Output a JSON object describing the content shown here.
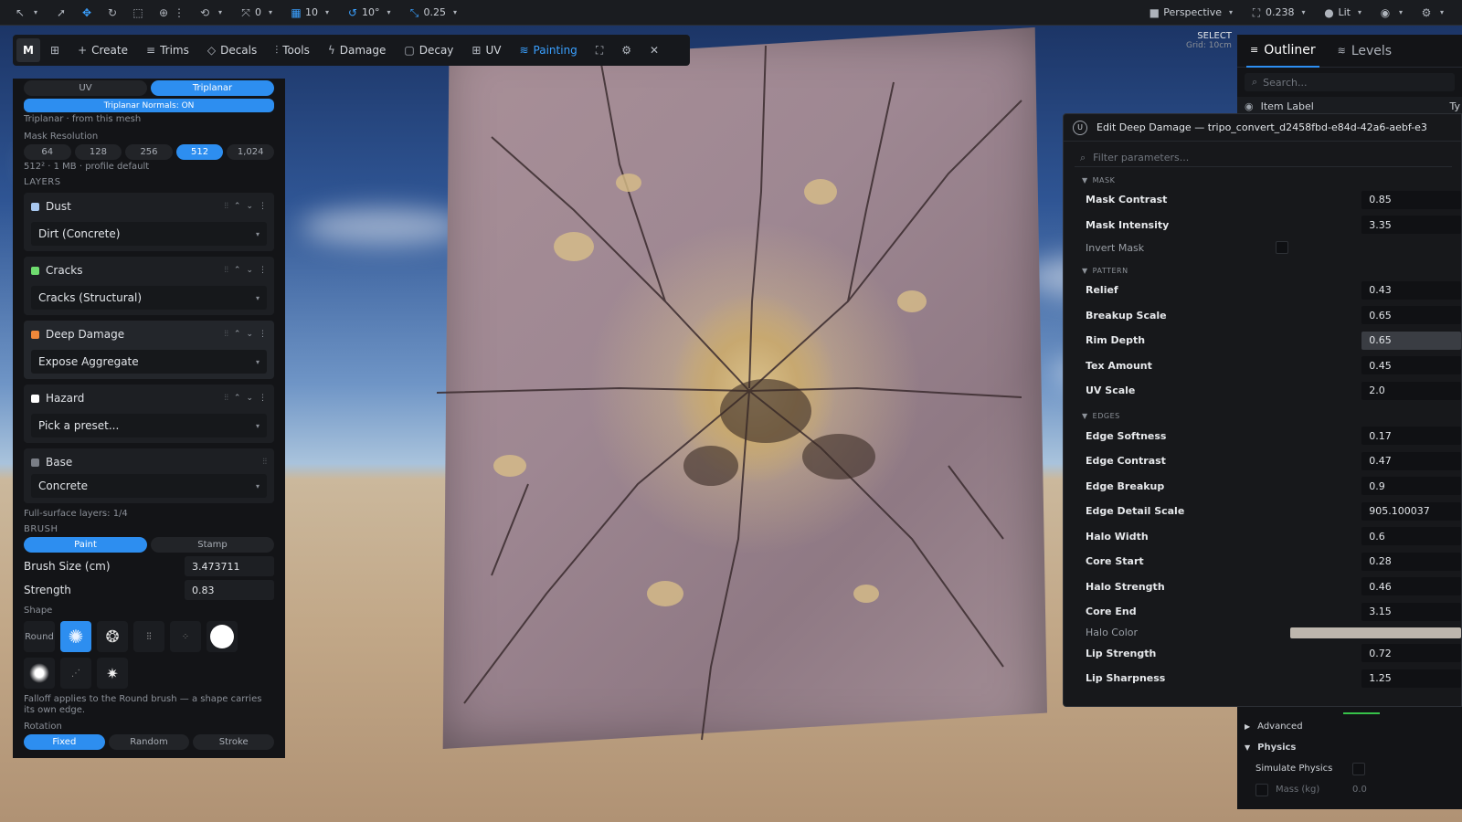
{
  "topbar": {
    "rot_snap": "0",
    "grid_snap": "10",
    "angle_snap": "10°",
    "scale_snap": "0.25",
    "view_mode": "Perspective",
    "camera_speed": "0.238",
    "lit_mode": "Lit"
  },
  "select_mode": {
    "label": "SELECT",
    "grid": "Grid: 10cm"
  },
  "toolbar": {
    "m_label": "M",
    "create": "Create",
    "trims": "Trims",
    "decals": "Decals",
    "tools": "Tools",
    "damage": "Damage",
    "decay": "Decay",
    "uv": "UV",
    "painting": "Painting"
  },
  "left_panel": {
    "mapping_uv": "UV",
    "mapping_triplanar": "Triplanar",
    "triplanar_normals": "Triplanar Normals: ON",
    "triplanar_note": "Triplanar · from this mesh",
    "mask_resolution_label": "Mask Resolution",
    "resolutions": [
      "64",
      "128",
      "256",
      "512",
      "1,024"
    ],
    "resolution_note": "512² · 1 MB · profile default",
    "layers_label": "LAYERS",
    "layers": [
      {
        "name": "Dust",
        "preset": "Dirt (Concrete)",
        "color": "#a8c8f0"
      },
      {
        "name": "Cracks",
        "preset": "Cracks (Structural)",
        "color": "#6fdc6f"
      },
      {
        "name": "Deep Damage",
        "preset": "Expose Aggregate",
        "color": "#f0883a"
      },
      {
        "name": "Hazard",
        "preset": "Pick a preset...",
        "color": "#ffffff"
      },
      {
        "name": "Base",
        "preset": "Concrete",
        "color": "#7a7e86"
      }
    ],
    "full_surface": "Full-surface layers: 1/4",
    "brush_label": "BRUSH",
    "brush_paint": "Paint",
    "brush_stamp": "Stamp",
    "brush_size_label": "Brush Size (cm)",
    "brush_size_value": "3.473711",
    "strength_label": "Strength",
    "strength_value": "0.83",
    "shape_label": "Shape",
    "shape_round": "Round",
    "falloff_note": "Falloff applies to the Round brush — a shape carries its own edge.",
    "rotation_label": "Rotation",
    "rotation_fixed": "Fixed",
    "rotation_random": "Random",
    "rotation_stroke": "Stroke"
  },
  "outliner": {
    "tab_outliner": "Outliner",
    "tab_levels": "Levels",
    "search_placeholder": "Search...",
    "col_item_label": "Item Label",
    "col_type": "Ty"
  },
  "edit_panel": {
    "title": "Edit Deep Damage — tripo_convert_d2458fbd-e84d-42a6-aebf-e3",
    "filter_placeholder": "Filter parameters...",
    "sections": {
      "mask": "MASK",
      "pattern": "PATTERN",
      "edges": "EDGES"
    },
    "mask_params": [
      {
        "name": "Mask Contrast",
        "value": "0.85"
      },
      {
        "name": "Mask Intensity",
        "value": "3.35"
      }
    ],
    "invert_mask": "Invert Mask",
    "pattern_params": [
      {
        "name": "Relief",
        "value": "0.43"
      },
      {
        "name": "Breakup Scale",
        "value": "0.65"
      },
      {
        "name": "Rim Depth",
        "value": "0.65"
      },
      {
        "name": "Tex Amount",
        "value": "0.45"
      },
      {
        "name": "UV Scale",
        "value": "2.0"
      }
    ],
    "edge_params": [
      {
        "name": "Edge Softness",
        "value": "0.17"
      },
      {
        "name": "Edge Contrast",
        "value": "0.47"
      },
      {
        "name": "Edge Breakup",
        "value": "0.9"
      },
      {
        "name": "Edge Detail Scale",
        "value": "905.100037"
      },
      {
        "name": "Halo Width",
        "value": "0.6"
      },
      {
        "name": "Core Start",
        "value": "0.28"
      },
      {
        "name": "Halo Strength",
        "value": "0.46"
      },
      {
        "name": "Core End",
        "value": "3.15"
      }
    ],
    "halo_color": "Halo Color",
    "tail_params": [
      {
        "name": "Lip Strength",
        "value": "0.72"
      },
      {
        "name": "Lip Sharpness",
        "value": "1.25"
      }
    ]
  },
  "details": {
    "advanced": "Advanced",
    "physics": "Physics",
    "simulate_physics": "Simulate Physics",
    "mass_label": "Mass (kg)",
    "mass_value": "0.0"
  }
}
